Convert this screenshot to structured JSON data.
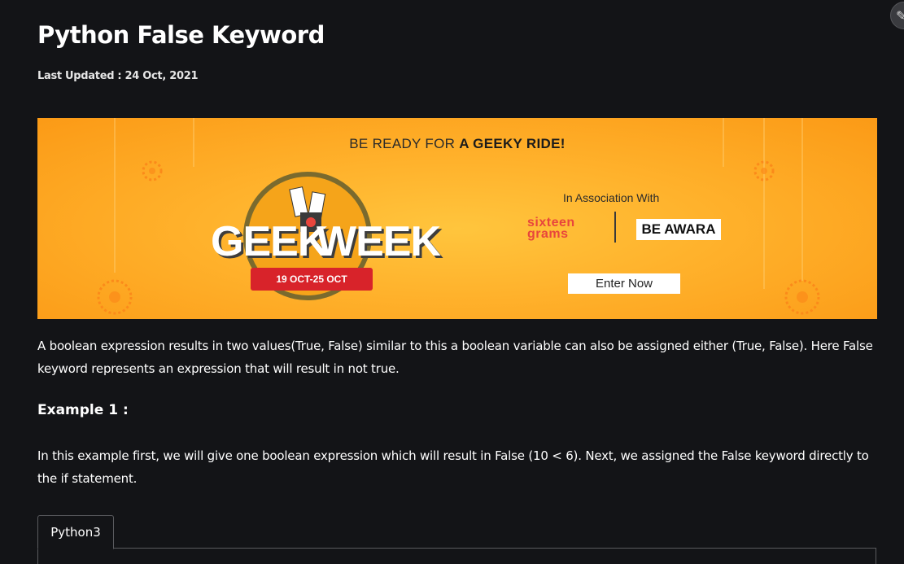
{
  "article": {
    "title": "Python False Keyword",
    "last_updated": "Last Updated : 24 Oct, 2021",
    "intro": "A boolean expression results in two values(True, False) similar to this a boolean variable can also be assigned either (True, False). Here False keyword represents an expression that will result in not true.",
    "example_heading": "Example 1 :",
    "example_text": "In this example first, we will give one boolean expression which will result in False (10 < 6). Next, we assigned the False keyword directly to the if statement."
  },
  "banner": {
    "headline_prefix": "BE READY FOR ",
    "headline_bold": "A GEEKY RIDE!",
    "brand_left": "GEEK",
    "brand_right": "WEEK",
    "dates": "19 OCT-25 OCT",
    "association": "In Association With",
    "partner1_line1": "sixteen",
    "partner1_line2": "grams",
    "partner2": "BE AWARA",
    "cta": "Enter Now",
    "colors": {
      "background": "#ffb12b",
      "ribbon": "#d8232a"
    }
  },
  "code_tabs": [
    {
      "label": "Python3"
    }
  ],
  "icons": {
    "edit": "pencil-icon"
  }
}
